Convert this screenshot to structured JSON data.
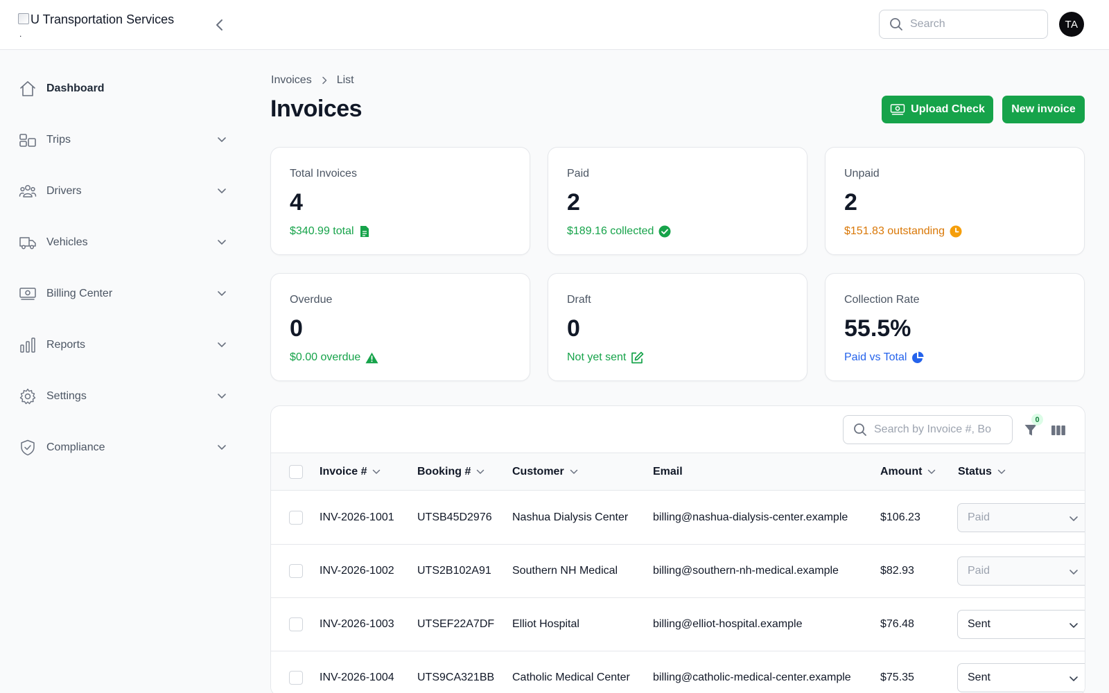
{
  "app": {
    "name": "U Transportation Services",
    "logo_dot": ".",
    "search_placeholder": "Search",
    "user_initials": "TA"
  },
  "sidebar": {
    "items": [
      {
        "label": "Dashboard",
        "icon": "home-icon",
        "expandable": false,
        "active": true
      },
      {
        "label": "Trips",
        "icon": "trips-icon",
        "expandable": true
      },
      {
        "label": "Drivers",
        "icon": "users-icon",
        "expandable": true
      },
      {
        "label": "Vehicles",
        "icon": "truck-icon",
        "expandable": true
      },
      {
        "label": "Billing Center",
        "icon": "banknote-icon",
        "expandable": true
      },
      {
        "label": "Reports",
        "icon": "bar-chart-icon",
        "expandable": true
      },
      {
        "label": "Settings",
        "icon": "gear-icon",
        "expandable": true
      },
      {
        "label": "Compliance",
        "icon": "shield-check-icon",
        "expandable": true
      }
    ]
  },
  "breadcrumb": {
    "root": "Invoices",
    "current": "List"
  },
  "page": {
    "title": "Invoices",
    "upload_label": "Upload Check",
    "new_label": "New invoice"
  },
  "stats": [
    {
      "label": "Total Invoices",
      "value": "4",
      "sub": "$340.99 total",
      "icon": "document-icon",
      "color": "#16a34a"
    },
    {
      "label": "Paid",
      "value": "2",
      "sub": "$189.16 collected",
      "icon": "check-circle-icon",
      "color": "#16a34a"
    },
    {
      "label": "Unpaid",
      "value": "2",
      "sub": "$151.83 outstanding",
      "icon": "clock-icon",
      "color": "#d97706"
    },
    {
      "label": "Overdue",
      "value": "0",
      "sub": "$0.00 overdue",
      "icon": "warning-icon",
      "color": "#16a34a"
    },
    {
      "label": "Draft",
      "value": "0",
      "sub": "Not yet sent",
      "icon": "edit-icon",
      "color": "#16a34a"
    },
    {
      "label": "Collection Rate",
      "value": "55.5%",
      "sub": "Paid vs Total",
      "icon": "pie-chart-icon",
      "color": "#2563eb"
    }
  ],
  "table": {
    "search_placeholder": "Search by Invoice #, Bo",
    "filter_count": "0",
    "columns": [
      "Invoice #",
      "Booking #",
      "Customer",
      "Email",
      "Amount",
      "Status"
    ],
    "rows": [
      {
        "invoice": "INV-2026-1001",
        "booking": "UTSB45D2976",
        "customer": "Nashua Dialysis Center",
        "email": "billing@nashua-dialysis-center.example",
        "amount": "$106.23",
        "status": "Paid"
      },
      {
        "invoice": "INV-2026-1002",
        "booking": "UTS2B102A91",
        "customer": "Southern NH Medical",
        "email": "billing@southern-nh-medical.example",
        "amount": "$82.93",
        "status": "Paid"
      },
      {
        "invoice": "INV-2026-1003",
        "booking": "UTSEF22A7DF",
        "customer": "Elliot Hospital",
        "email": "billing@elliot-hospital.example",
        "amount": "$76.48",
        "status": "Sent"
      },
      {
        "invoice": "INV-2026-1004",
        "booking": "UTS9CA321BB",
        "customer": "Catholic Medical Center",
        "email": "billing@catholic-medical-center.example",
        "amount": "$75.35",
        "status": "Sent"
      }
    ]
  },
  "colors": {
    "accent": "#16a34a",
    "warning": "#d97706",
    "info": "#2563eb"
  }
}
